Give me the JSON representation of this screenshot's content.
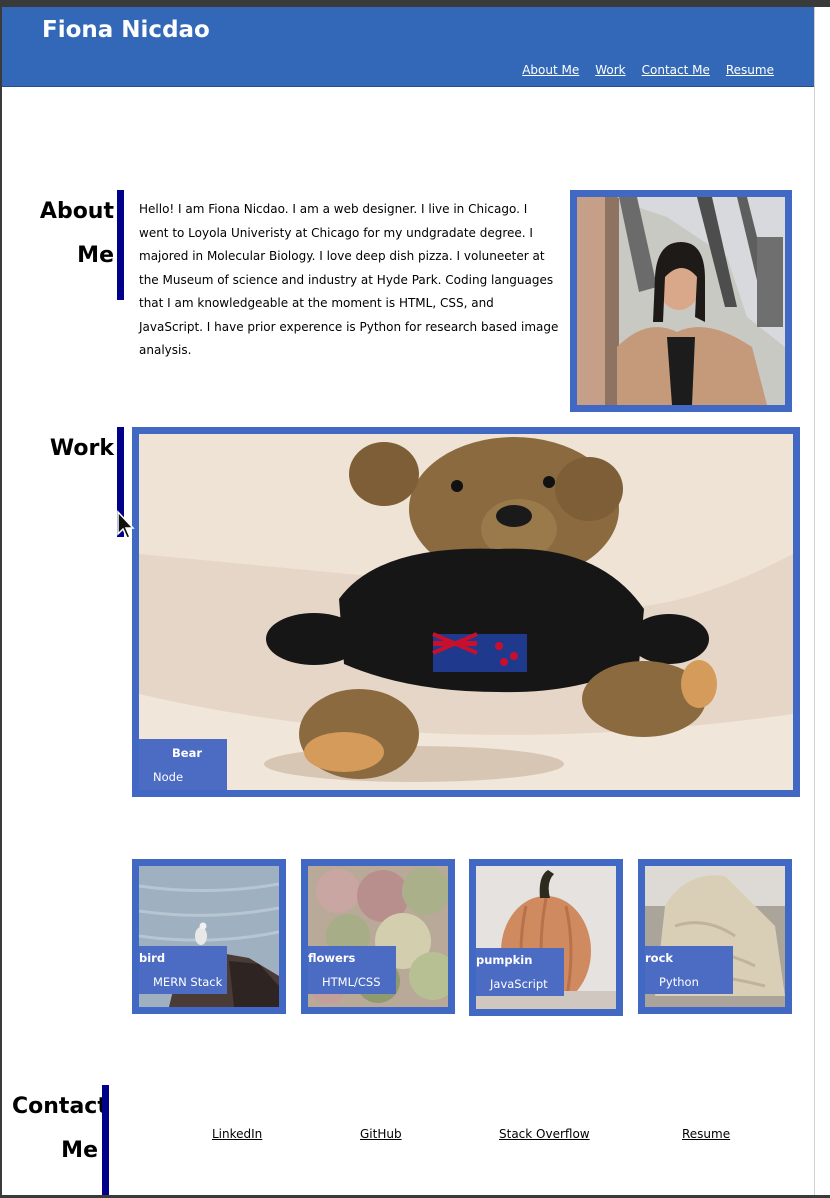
{
  "header": {
    "site_title": "Fiona Nicdao",
    "nav": [
      "About Me",
      "Work",
      "Contact Me",
      "Resume"
    ]
  },
  "about": {
    "title_line1": "About",
    "title_line2": "Me",
    "text": "Hello! I am Fiona Nicdao. I am a web designer. I live in Chicago. I went to Loyola Univeristy at Chicago for my undgradate degree. I majored in Molecular Biology. I love deep dish pizza. I voluneeter at the Museum of science and industry at Hyde Park. Coding languages that I am knowledgeable at the moment is HTML, CSS, and JavaScript. I have prior experence is Python for research based image analysis."
  },
  "work": {
    "title": "Work",
    "featured": {
      "name": "Bear",
      "tech": "Node"
    },
    "projects": [
      {
        "name": "bird",
        "tech": "MERN Stack"
      },
      {
        "name": "flowers",
        "tech": "HTML/CSS"
      },
      {
        "name": "pumpkin",
        "tech": "JavaScript"
      },
      {
        "name": "rock",
        "tech": "Python"
      }
    ]
  },
  "contact": {
    "title_line1": "Contact",
    "title_line2": "Me",
    "links": [
      "LinkedIn",
      "GitHub",
      "Stack Overflow",
      "Resume"
    ]
  },
  "colors": {
    "header": "#3268b7",
    "frame": "#4169c4",
    "caption": "#4c6cc4",
    "accent_bar": "#00008a"
  },
  "icons": [
    "mouse-pointer-icon"
  ]
}
